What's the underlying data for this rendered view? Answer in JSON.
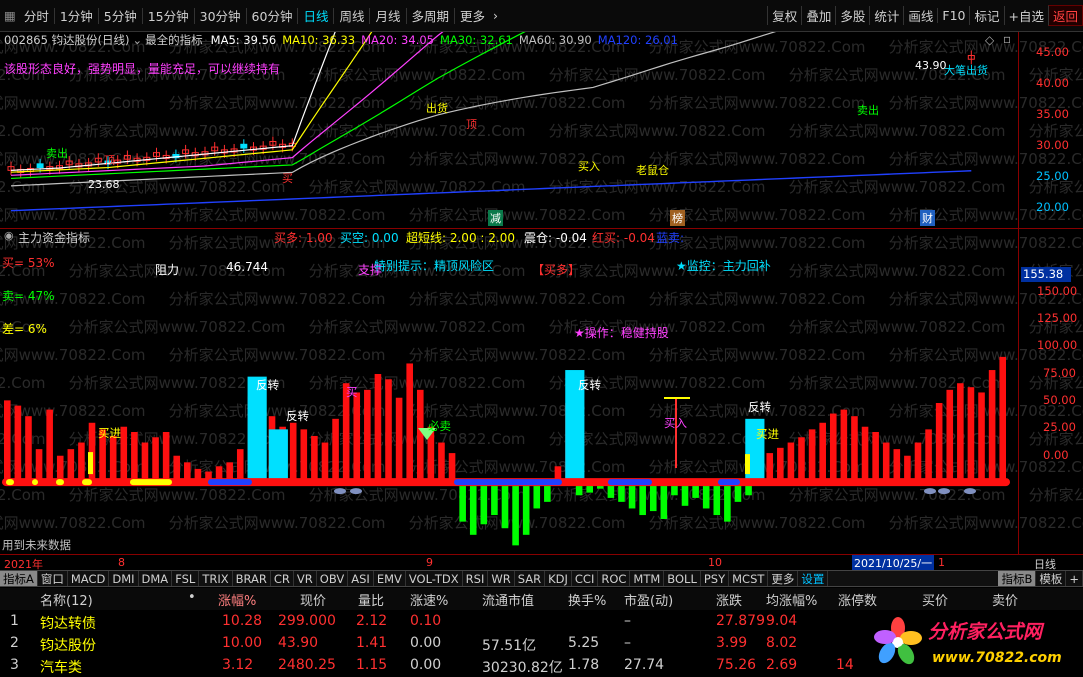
{
  "toolbar": {
    "periods": [
      "分时",
      "1分钟",
      "5分钟",
      "15分钟",
      "30分钟",
      "60分钟",
      "日线",
      "周线",
      "月线",
      "多周期",
      "更多"
    ],
    "active_period": "日线",
    "right_buttons": [
      "复权",
      "叠加",
      "多股",
      "统计",
      "画线",
      "F10",
      "标记",
      "+自选",
      "返回"
    ]
  },
  "stock": {
    "code_name": "002865 钧达股份(日线)",
    "indicator_name": "最全的指标",
    "ma": [
      {
        "label": "MA5: 39.56",
        "color": "#ffffff"
      },
      {
        "label": "MA10: 36.33",
        "color": "#ffff00"
      },
      {
        "label": "MA20: 34.05",
        "color": "#ff40ff"
      },
      {
        "label": "MA30: 32.61",
        "color": "#00ff00"
      },
      {
        "label": "MA60: 30.90",
        "color": "#c0c0c0"
      },
      {
        "label": "MA120: 26.01",
        "color": "#2040ff"
      }
    ],
    "comment": "该股形态良好，强势明显，量能充足，可以继续持有",
    "high_label": "43.90",
    "price_ticks": [
      "45.00",
      "40.00",
      "35.00",
      "30.00",
      "25.00",
      "20.00"
    ],
    "low_label": "23.68",
    "markers": [
      "卖出",
      "顶",
      "出货",
      "买",
      "顶",
      "买入",
      "老鼠仓",
      "卖出",
      "大笔出货",
      "减",
      "榜",
      "财",
      "进",
      "卖出"
    ]
  },
  "indicator": {
    "title": "主力资金指标",
    "stats": [
      {
        "label": "买多: 1.00",
        "color": "#ff3030"
      },
      {
        "label": "买空: 0.00",
        "color": "#00e0ff"
      },
      {
        "label": "超短线: 2.00 : 2.00",
        "color": "#ffff00"
      },
      {
        "label": "震仓: -0.04",
        "color": "#ffffff"
      },
      {
        "label": "红买: -0.04",
        "color": "#ff3030"
      },
      {
        "label": "蓝卖:",
        "color": "#2040ff"
      }
    ],
    "buy_pct": "买= 53%",
    "sell_pct": "卖= 47%",
    "diff_pct": "差= 6%",
    "resistance_label": "阻力",
    "resistance_value": "46.744",
    "support_label": "支撑",
    "special_tip": "特别提示：精顶风险区",
    "buy_tag": "【买多】",
    "monitor": "★监控：主力回补",
    "operation": "★操作：稳健持股",
    "current_value": "155.38",
    "ticks": [
      "150.00",
      "125.00",
      "100.00",
      "75.00",
      "50.00",
      "25.00",
      "0.00"
    ],
    "labels": [
      "反转",
      "反转",
      "反转",
      "反转",
      "买进",
      "买进",
      "买入",
      "必卖",
      "买"
    ],
    "future_note": "用到未来数据"
  },
  "chart_data": {
    "type": "bar",
    "title": "主力资金指标",
    "ylim": [
      -50,
      170
    ],
    "values": [
      62,
      58,
      50,
      25,
      55,
      20,
      25,
      30,
      45,
      40,
      35,
      42,
      38,
      30,
      34,
      38,
      20,
      15,
      10,
      8,
      12,
      15,
      25,
      65,
      70,
      50,
      42,
      45,
      40,
      35,
      30,
      48,
      75,
      68,
      70,
      82,
      78,
      64,
      90,
      70,
      42,
      30,
      22,
      -30,
      -40,
      -32,
      -25,
      -35,
      -48,
      -40,
      -20,
      -15,
      12,
      60,
      -10,
      -8,
      -5,
      -12,
      -15,
      -20,
      -25,
      -22,
      -28,
      -10,
      -18,
      -12,
      -20,
      -25,
      -30,
      -15,
      -10,
      20,
      22,
      26,
      30,
      34,
      40,
      45,
      52,
      55,
      50,
      42,
      38,
      30,
      25,
      20,
      30,
      40,
      60,
      70,
      75,
      72,
      68,
      85,
      95
    ],
    "cyan_segments": [
      [
        23,
        25,
        80
      ],
      [
        25,
        27,
        40
      ],
      [
        53,
        55,
        85
      ],
      [
        70,
        72,
        48
      ]
    ],
    "dates": [
      "2021年",
      "8",
      "9",
      "10",
      "2021/10/25/一",
      "1"
    ]
  },
  "date_axis": {
    "start": "2021年",
    "m8": "8",
    "m9": "9",
    "m10": "10",
    "cursor": "2021/10/25/一",
    "end": "1",
    "period": "日线"
  },
  "tabs": [
    "指标A",
    "窗口",
    "MACD",
    "DMI",
    "DMA",
    "FSL",
    "TRIX",
    "BRAR",
    "CR",
    "VR",
    "OBV",
    "ASI",
    "EMV",
    "VOL-TDX",
    "RSI",
    "WR",
    "SAR",
    "KDJ",
    "CCI",
    "ROC",
    "MTM",
    "BOLL",
    "PSY",
    "MCST",
    "更多",
    "设置"
  ],
  "tabs_right": [
    "指标B",
    "模板",
    "+"
  ],
  "list": {
    "headers": [
      "名称(12)",
      "•",
      "涨幅%",
      "现价",
      "量比",
      "涨速%",
      "流通市值",
      "换手%",
      "市盈(动)",
      "涨跌",
      "均涨幅%",
      "涨停数",
      "买价",
      "卖价"
    ],
    "rows": [
      {
        "idx": "1",
        "name": "钧达转债",
        "pct": "10.28",
        "price": "299.000",
        "vr": "2.12",
        "speed": "0.10",
        "mcap": "",
        "turn": "",
        "pe": "–",
        "chg": "27.879",
        "avg": "9.04",
        "limit": "",
        "bid": "",
        "ask": ""
      },
      {
        "idx": "2",
        "name": "钧达股份",
        "pct": "10.00",
        "price": "43.90",
        "vr": "1.41",
        "speed": "0.00",
        "mcap": "57.51亿",
        "turn": "5.25",
        "pe": "–",
        "chg": "3.99",
        "avg": "8.02",
        "limit": "",
        "bid": "",
        "ask": ""
      },
      {
        "idx": "3",
        "name": "汽车类",
        "pct": "3.12",
        "price": "2480.25",
        "vr": "1.15",
        "speed": "0.00",
        "mcap": "30230.82亿",
        "turn": "1.78",
        "pe": "27.74",
        "chg": "75.26",
        "avg": "2.69",
        "limit": "14",
        "bid": "",
        "ask": ""
      }
    ]
  },
  "watermark": "分析家公式网www.70822.Com",
  "logo": {
    "title": "分析家公式网",
    "url": "www.70822.com"
  }
}
